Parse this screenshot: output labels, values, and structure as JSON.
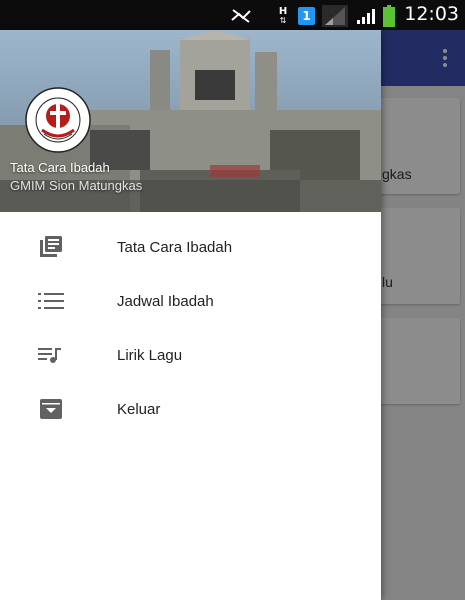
{
  "status_bar": {
    "time": "12:03",
    "sim_badge": "1",
    "network_h": "H",
    "icons": [
      "mute-icon",
      "data-h-icon",
      "sim-1-icon",
      "signal-1-icon",
      "signal-2-icon",
      "battery-icon"
    ]
  },
  "drawer": {
    "header": {
      "title": "Tata Cara Ibadah",
      "subtitle": "GMIM Sion Matungkas"
    },
    "items": [
      {
        "label": "Tata Cara Ibadah",
        "icon": "library-books-icon"
      },
      {
        "label": "Jadwal Ibadah",
        "icon": "list-icon"
      },
      {
        "label": "Lirik Lagu",
        "icon": "queue-music-icon"
      },
      {
        "label": "Keluar",
        "icon": "archive-icon"
      }
    ]
  },
  "background_app": {
    "card_fragments": [
      "gkas",
      "lu"
    ]
  },
  "colors": {
    "toolbar": "#3f51b5",
    "status_bar": "#0c0c0c",
    "icon_gray": "#616161",
    "sim_badge": "#2196f3",
    "battery": "#5bc236"
  }
}
